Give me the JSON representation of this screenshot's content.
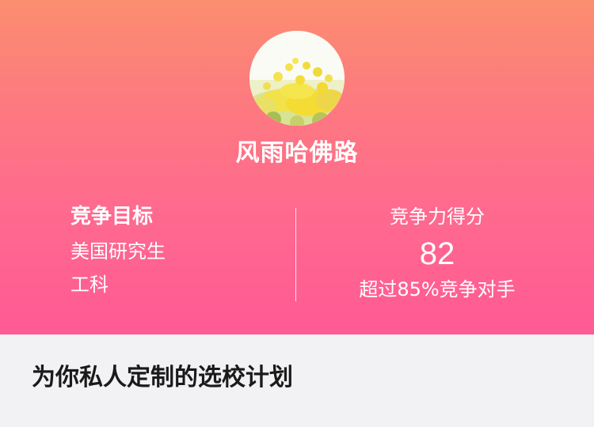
{
  "profile": {
    "username": "风雨哈佛路",
    "avatar_icon": "flower-field-avatar"
  },
  "goal": {
    "title": "竞争目标",
    "lines": [
      "美国研究生",
      "工科"
    ]
  },
  "score": {
    "label": "竞争力得分",
    "value": "82",
    "description": "超过85%竞争对手"
  },
  "plan": {
    "title": "为你私人定制的选校计划"
  },
  "colors": {
    "gradient_top": "#fb8e6f",
    "gradient_bottom": "#ff5a94",
    "page_bg": "#f2f2f5",
    "text_light": "#ffffff",
    "text_dark": "#1a1a1a"
  }
}
